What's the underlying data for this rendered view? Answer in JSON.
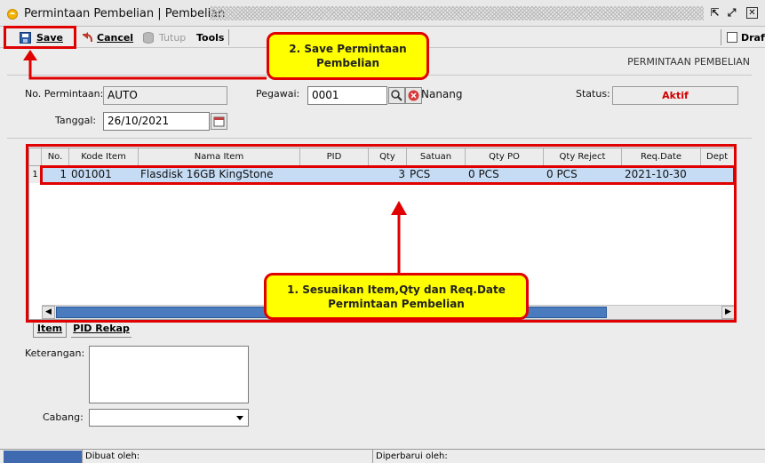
{
  "window": {
    "title": "Permintaan Pembelian | Pembelian",
    "restore_glyph": "⇱",
    "maximize_glyph": "⤢",
    "close_glyph": "✕"
  },
  "toolbar": {
    "save_label": "Save",
    "cancel_label": "Cancel",
    "tutup_label": "Tutup",
    "tools_label": "Tools",
    "draft_label": "Draft"
  },
  "header": {
    "section_title": "PERMINTAAN PEMBELIAN"
  },
  "form": {
    "no_permintaan_label": "No. Permintaan:",
    "no_permintaan_value": "AUTO",
    "pegawai_label": "Pegawai:",
    "pegawai_code": "0001",
    "pegawai_name": "Nanang",
    "status_label": "Status:",
    "status_value": "Aktif",
    "tanggal_label": "Tanggal:",
    "tanggal_value": "26/10/2021"
  },
  "grid": {
    "columns": [
      "No.",
      "Kode Item",
      "Nama Item",
      "PID",
      "Qty",
      "Satuan",
      "Qty PO",
      "Qty Reject",
      "Req.Date",
      "Dept"
    ],
    "rows": [
      {
        "row_num": "1",
        "no": "1",
        "kode_item": "001001",
        "nama_item": "Flasdisk 16GB KingStone",
        "pid": "",
        "qty": "3",
        "satuan": "PCS",
        "qty_po": "0 PCS",
        "qty_reject": "0 PCS",
        "req_date": "2021-10-30",
        "dept": ""
      }
    ]
  },
  "tabs": [
    {
      "label": "Item"
    },
    {
      "label": "PID Rekap"
    }
  ],
  "bottom": {
    "keterangan_label": "Keterangan:",
    "cabang_label": "Cabang:"
  },
  "statusbar": {
    "dibuat_label": "Dibuat oleh:",
    "diperbarui_label": "Diperbarui oleh:"
  },
  "annotations": {
    "callout_save": "2. Save Permintaan Pembelian",
    "callout_items": "1. Sesuaikan Item,Qty dan Req.Date Permintaan Pembelian"
  },
  "colors": {
    "annotation_red": "#e00000",
    "callout_yellow": "#ffff00",
    "selected_row": "#c6dcf5",
    "status_text_red": "#d00000"
  }
}
